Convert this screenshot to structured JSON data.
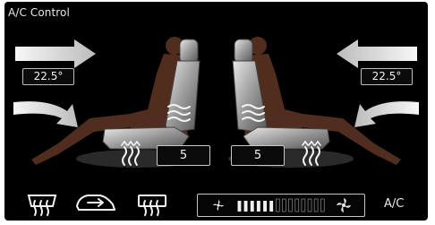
{
  "title": "A/C Control",
  "left_zone": {
    "temperature": "22.5°",
    "seat_level": "5"
  },
  "right_zone": {
    "temperature": "22.5°",
    "seat_level": "5"
  },
  "bottom_bar": {
    "icons": [
      "rear-defrost-icon",
      "recirculation-icon",
      "front-defrost-icon"
    ],
    "fan": {
      "level": 6,
      "max": 14
    },
    "ac_label": "A/C"
  }
}
